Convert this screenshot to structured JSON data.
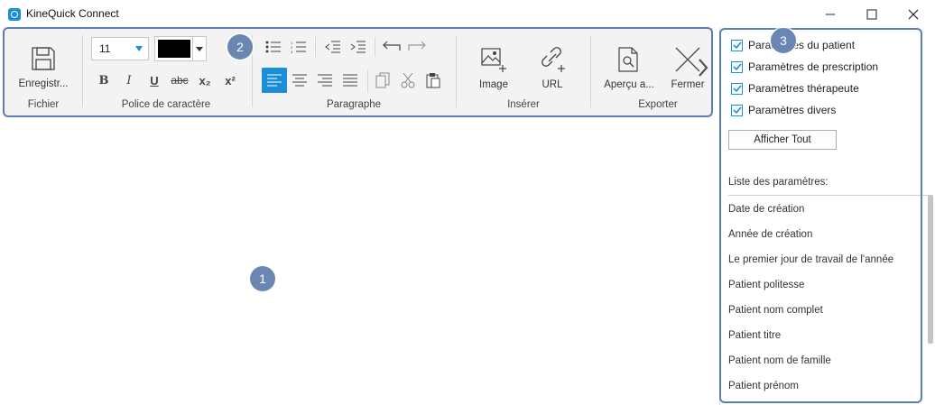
{
  "window": {
    "title": "KineQuick Connect",
    "minimize_icon": "minimize-icon",
    "maximize_icon": "maximize-icon",
    "close_icon": "close-icon"
  },
  "ribbon": {
    "fichier": {
      "group_label": "Fichier",
      "save_label": "Enregistr..."
    },
    "police": {
      "group_label": "Police de caractère",
      "font_size": "11",
      "color": "#000000",
      "buttons": [
        "B",
        "I",
        "U",
        "abc",
        "x₂",
        "x²"
      ]
    },
    "paragraphe": {
      "group_label": "Paragraphe"
    },
    "inserer": {
      "group_label": "Insérer",
      "image_label": "Image",
      "url_label": "URL"
    },
    "exporter": {
      "group_label": "Exporter",
      "preview_label": "Aperçu a...",
      "close_label": "Fermer"
    }
  },
  "callouts": {
    "c1": "1",
    "c2": "2",
    "c3": "3"
  },
  "side": {
    "checkboxes": [
      {
        "label": "Paramètres du patient",
        "checked": true
      },
      {
        "label": "Paramètres de prescription",
        "checked": true
      },
      {
        "label": "Paramètres thérapeute",
        "checked": true
      },
      {
        "label": "Paramètres divers",
        "checked": true
      }
    ],
    "show_all_label": "Afficher Tout",
    "params_title": "Liste des paramètres:",
    "params": [
      "Date de création",
      "Année de création",
      "Le premier jour de travail de l'année",
      "Patient politesse",
      "Patient nom complet",
      "Patient titre",
      "Patient nom de famille",
      "Patient prénom"
    ]
  },
  "colors": {
    "accent": "#1a8fd8",
    "callout": "#6a87b4",
    "frame": "#5b7fb3"
  }
}
